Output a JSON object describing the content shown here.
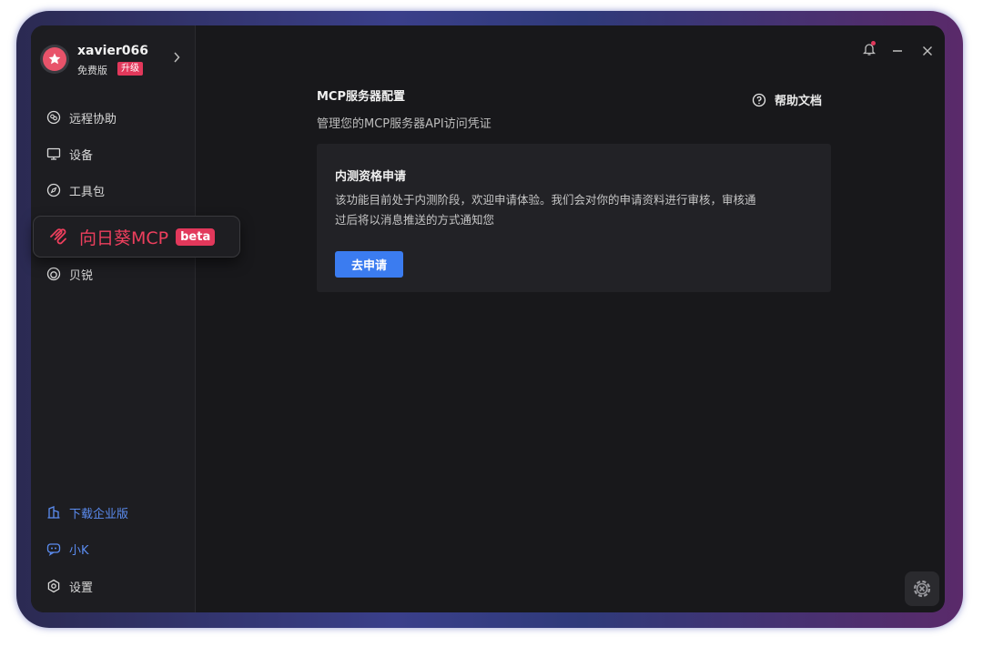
{
  "user": {
    "name": "xavier066",
    "plan": "免费版",
    "upgrade_label": "升级"
  },
  "sidebar": {
    "items": [
      {
        "label": "远程协助",
        "icon": "remote-assist-icon"
      },
      {
        "label": "设备",
        "icon": "monitor-icon"
      },
      {
        "label": "工具包",
        "icon": "compass-icon"
      },
      {
        "label": "向日葵MCP",
        "icon": "mcp-logo-icon",
        "badge": "beta",
        "active": true
      },
      {
        "label": "贝锐",
        "icon": "ring-icon"
      }
    ],
    "bottom": [
      {
        "label": "下载企业版",
        "icon": "building-icon"
      },
      {
        "label": "小K",
        "icon": "chat-bot-icon"
      },
      {
        "label": "设置",
        "icon": "hexagon-gear-icon"
      }
    ]
  },
  "main": {
    "title": "MCP服务器配置",
    "subtitle": "管理您的MCP服务器API访问凭证",
    "help_label": "帮助文档",
    "card": {
      "title": "内测资格申请",
      "description_line1": "该功能目前处于内测阶段，欢迎申请体验。我们会对你的申请资料进行审核，审核通",
      "description_line2": "过后将以消息推送的方式通知您",
      "button_label": "去申请"
    }
  },
  "colors": {
    "accent_red": "#e2385b",
    "accent_blue": "#3b7cf0",
    "link_blue": "#5b8cf0",
    "bg_dark": "#18181b"
  }
}
